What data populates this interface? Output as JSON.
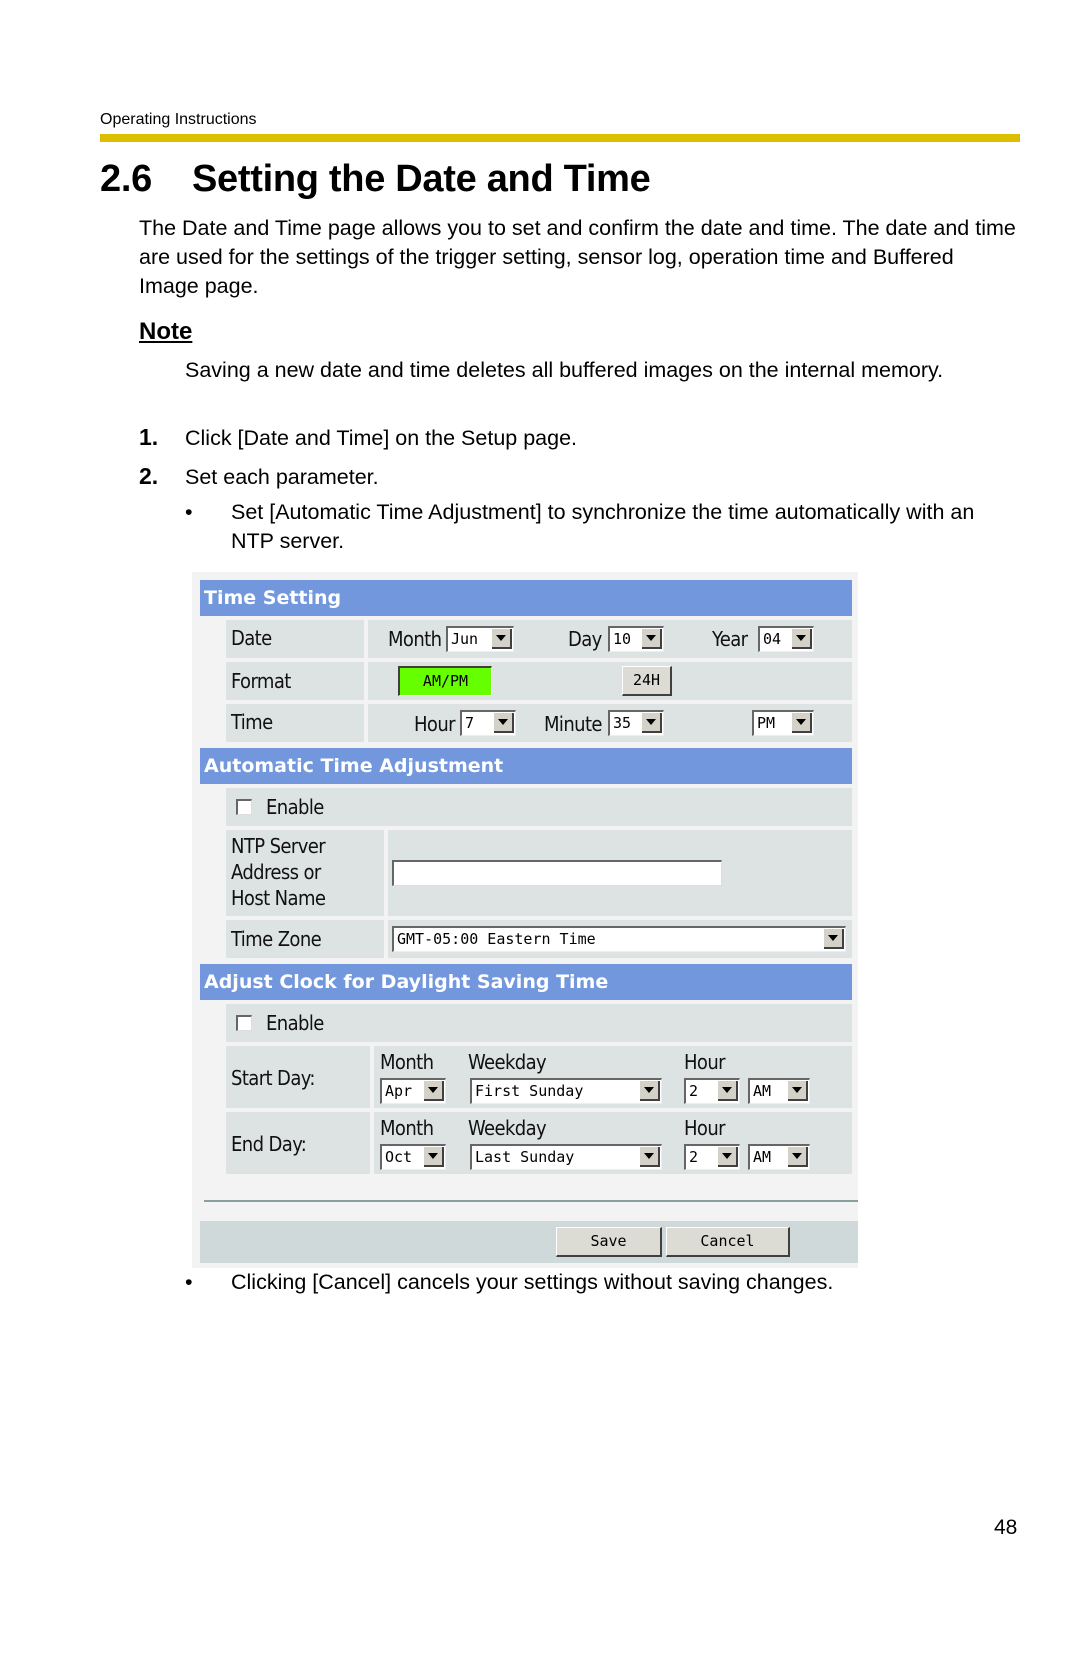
{
  "header": {
    "running_head": "Operating Instructions",
    "section_number": "2.6",
    "title": "Setting the Date and Time"
  },
  "intro": "The Date and Time page allows you to set and confirm the date and time. The date and time are used for the settings of the trigger setting, sensor log, operation time and Buffered Image page.",
  "note": {
    "heading": "Note",
    "body": "Saving a new date and time deletes all buffered images on the internal memory."
  },
  "steps": [
    {
      "number": "1.",
      "text": "Click [Date and Time] on the Setup page."
    },
    {
      "number": "2.",
      "text": "Set each parameter."
    }
  ],
  "bullets": [
    {
      "symbol": "•",
      "text": "Set [Automatic Time Adjustment] to synchronize the time automatically with an NTP server."
    },
    {
      "symbol": "•",
      "text": "Clicking [Cancel] cancels your settings without saving changes."
    }
  ],
  "form": {
    "time_setting": {
      "heading": "Time Setting",
      "date_label": "Date",
      "month_label": "Month",
      "month_value": "Jun",
      "day_label": "Day",
      "day_value": "10",
      "year_label": "Year",
      "year_value": "04",
      "format_label": "Format",
      "format_ampm": "AM/PM",
      "format_24h": "24H",
      "format_selected": "AM/PM",
      "time_label": "Time",
      "hour_label": "Hour",
      "hour_value": "7",
      "minute_label": "Minute",
      "minute_value": "35",
      "ampm_value": "PM",
      "active_color": "#66ff00"
    },
    "auto_adjust": {
      "heading": "Automatic Time Adjustment",
      "enable_label": "Enable",
      "enable_checked": false,
      "ntp_label_1": "NTP Server",
      "ntp_label_2": "Address or",
      "ntp_label_3": "Host Name",
      "ntp_value": "",
      "timezone_label": "Time Zone",
      "timezone_value": "GMT-05:00 Eastern Time"
    },
    "dst": {
      "heading": "Adjust Clock for Daylight Saving Time",
      "enable_label": "Enable",
      "enable_checked": false,
      "month_label": "Month",
      "weekday_label": "Weekday",
      "hour_label": "Hour",
      "start": {
        "label": "Start Day:",
        "month": "Apr",
        "weekday": "First Sunday",
        "hour": "2",
        "ampm": "AM"
      },
      "end": {
        "label": "End Day:",
        "month": "Oct",
        "weekday": "Last Sunday",
        "hour": "2",
        "ampm": "AM"
      }
    },
    "buttons": {
      "save": "Save",
      "cancel": "Cancel"
    },
    "header_color": "#7297dc"
  },
  "page_number": "48"
}
